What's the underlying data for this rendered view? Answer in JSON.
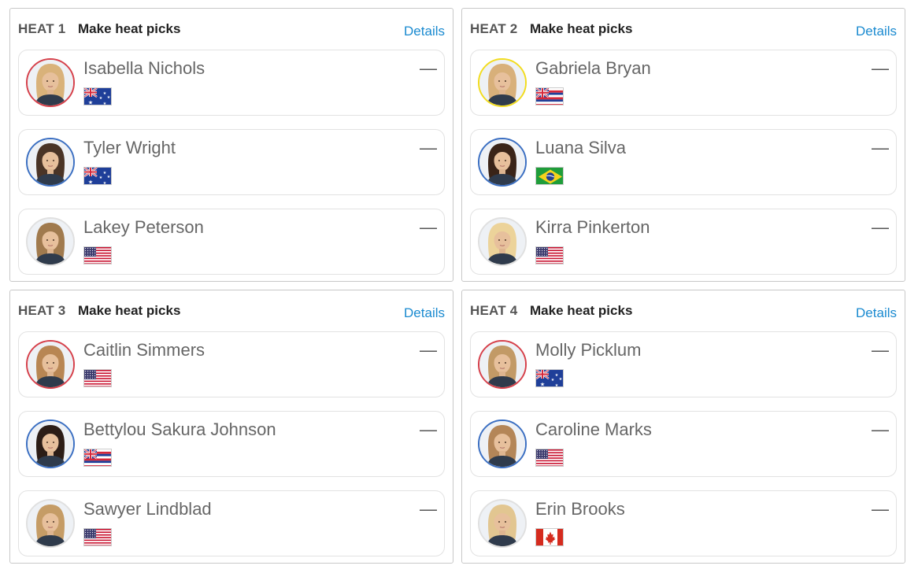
{
  "colors": {
    "details_link": "#1a8ad0",
    "seed_red": "#d6404a",
    "seed_blue": "#3b6fc2",
    "seed_yellow": "#f2dc1e",
    "seed_white": "#e0e0e0"
  },
  "heats": [
    {
      "label": "HEAT 1",
      "picks_label": "Make heat picks",
      "details_label": "Details",
      "athletes": [
        {
          "name": "Isabella Nichols",
          "country_flag": "flag-australia",
          "ring_color": "#d6404a",
          "hair_color": "#d9b27a",
          "score": "—"
        },
        {
          "name": "Tyler Wright",
          "country_flag": "flag-australia",
          "ring_color": "#3b6fc2",
          "hair_color": "#4a3426",
          "score": "—"
        },
        {
          "name": "Lakey Peterson",
          "country_flag": "flag-usa",
          "ring_color": "#e0e0e0",
          "hair_color": "#a07a4e",
          "score": "—"
        }
      ]
    },
    {
      "label": "HEAT 2",
      "picks_label": "Make heat picks",
      "details_label": "Details",
      "athletes": [
        {
          "name": "Gabriela Bryan",
          "country_flag": "flag-hawaii",
          "ring_color": "#f2dc1e",
          "hair_color": "#d8b07a",
          "score": "—"
        },
        {
          "name": "Luana Silva",
          "country_flag": "flag-brazil",
          "ring_color": "#3b6fc2",
          "hair_color": "#3a2418",
          "score": "—"
        },
        {
          "name": "Kirra Pinkerton",
          "country_flag": "flag-usa",
          "ring_color": "#e0e0e0",
          "hair_color": "#ecd39a",
          "score": "—"
        }
      ]
    },
    {
      "label": "HEAT 3",
      "picks_label": "Make heat picks",
      "details_label": "Details",
      "athletes": [
        {
          "name": "Caitlin Simmers",
          "country_flag": "flag-usa",
          "ring_color": "#d6404a",
          "hair_color": "#b88653",
          "score": "—"
        },
        {
          "name": "Bettylou Sakura Johnson",
          "country_flag": "flag-hawaii",
          "ring_color": "#3b6fc2",
          "hair_color": "#2c1d16",
          "score": "—"
        },
        {
          "name": "Sawyer Lindblad",
          "country_flag": "flag-usa",
          "ring_color": "#e0e0e0",
          "hair_color": "#c59c66",
          "score": "—"
        }
      ]
    },
    {
      "label": "HEAT 4",
      "picks_label": "Make heat picks",
      "details_label": "Details",
      "athletes": [
        {
          "name": "Molly Picklum",
          "country_flag": "flag-australia",
          "ring_color": "#d6404a",
          "hair_color": "#c29a66",
          "score": "—"
        },
        {
          "name": "Caroline Marks",
          "country_flag": "flag-usa",
          "ring_color": "#3b6fc2",
          "hair_color": "#b48658",
          "score": "—"
        },
        {
          "name": "Erin Brooks",
          "country_flag": "flag-canada",
          "ring_color": "#e0e0e0",
          "hair_color": "#e2c691",
          "score": "—"
        }
      ]
    }
  ]
}
